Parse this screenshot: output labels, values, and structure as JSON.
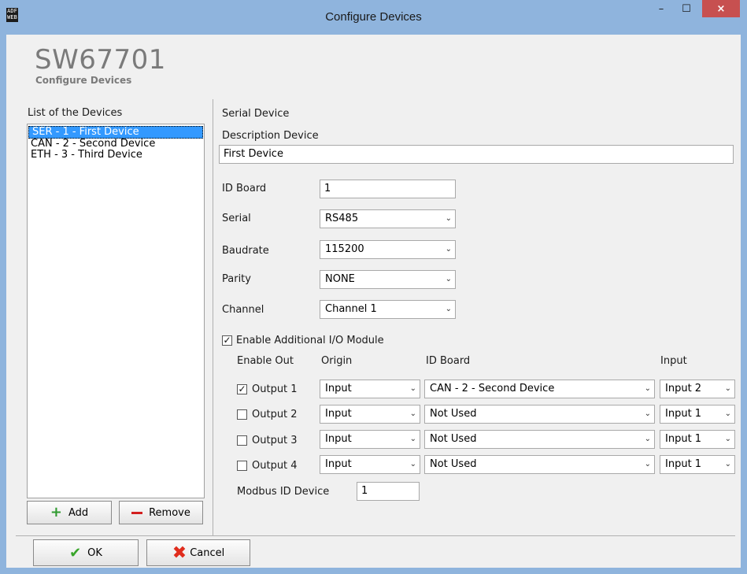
{
  "window": {
    "title": "Configure Devices",
    "app_icon": "ADF WEB",
    "close_glyph": "×",
    "min_glyph": "–",
    "max_glyph": "☐"
  },
  "header": {
    "title": "SW67701",
    "subtitle": "Configure Devices"
  },
  "devices": {
    "label": "List of the Devices",
    "items": [
      "SER - 1 - First Device",
      "CAN - 2 - Second Device",
      "ETH - 3 - Third Device"
    ],
    "selected_index": 0,
    "add_label": "Add",
    "remove_label": "Remove"
  },
  "form": {
    "section": "Serial Device",
    "description_label": "Description Device",
    "description_value": "First Device",
    "id_board_label": "ID Board",
    "id_board_value": "1",
    "serial_label": "Serial",
    "serial_value": "RS485",
    "baudrate_label": "Baudrate",
    "baudrate_value": "115200",
    "parity_label": "Parity",
    "parity_value": "NONE",
    "channel_label": "Channel",
    "channel_value": "Channel 1"
  },
  "io": {
    "enable_label": "Enable Additional I/O Module",
    "enable_checked": true,
    "col_enable_out": "Enable Out",
    "col_origin": "Origin",
    "col_id_board": "ID Board",
    "col_input": "Input",
    "outputs": [
      {
        "label": "Output 1",
        "checked": true,
        "origin": "Input",
        "id_board": "CAN - 2 - Second Device",
        "input": "Input 2"
      },
      {
        "label": "Output 2",
        "checked": false,
        "origin": "Input",
        "id_board": "Not Used",
        "input": "Input 1"
      },
      {
        "label": "Output 3",
        "checked": false,
        "origin": "Input",
        "id_board": "Not Used",
        "input": "Input 1"
      },
      {
        "label": "Output 4",
        "checked": false,
        "origin": "Input",
        "id_board": "Not Used",
        "input": "Input 1"
      }
    ],
    "modbus_label": "Modbus ID Device",
    "modbus_value": "1"
  },
  "footer": {
    "ok_label": "OK",
    "cancel_label": "Cancel"
  },
  "colors": {
    "titlebar": "#8fb4dd",
    "selection": "#3399ff",
    "close": "#c75050"
  }
}
